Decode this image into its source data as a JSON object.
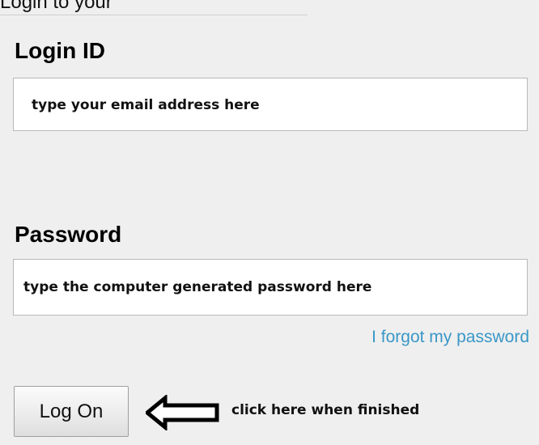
{
  "top_strip": {
    "partial_text": "Login to your"
  },
  "login": {
    "label": "Login ID",
    "hint": "type your email address here"
  },
  "password": {
    "label": "Password",
    "hint": "type the computer generated password here",
    "forgot_link": "I forgot my password"
  },
  "actions": {
    "logon_button": "Log On",
    "arrow_icon": "left-arrow-icon",
    "hint": "click here when finished"
  },
  "colors": {
    "background": "#efefef",
    "link": "#3a97c7",
    "input_border": "#b9b9b9"
  }
}
